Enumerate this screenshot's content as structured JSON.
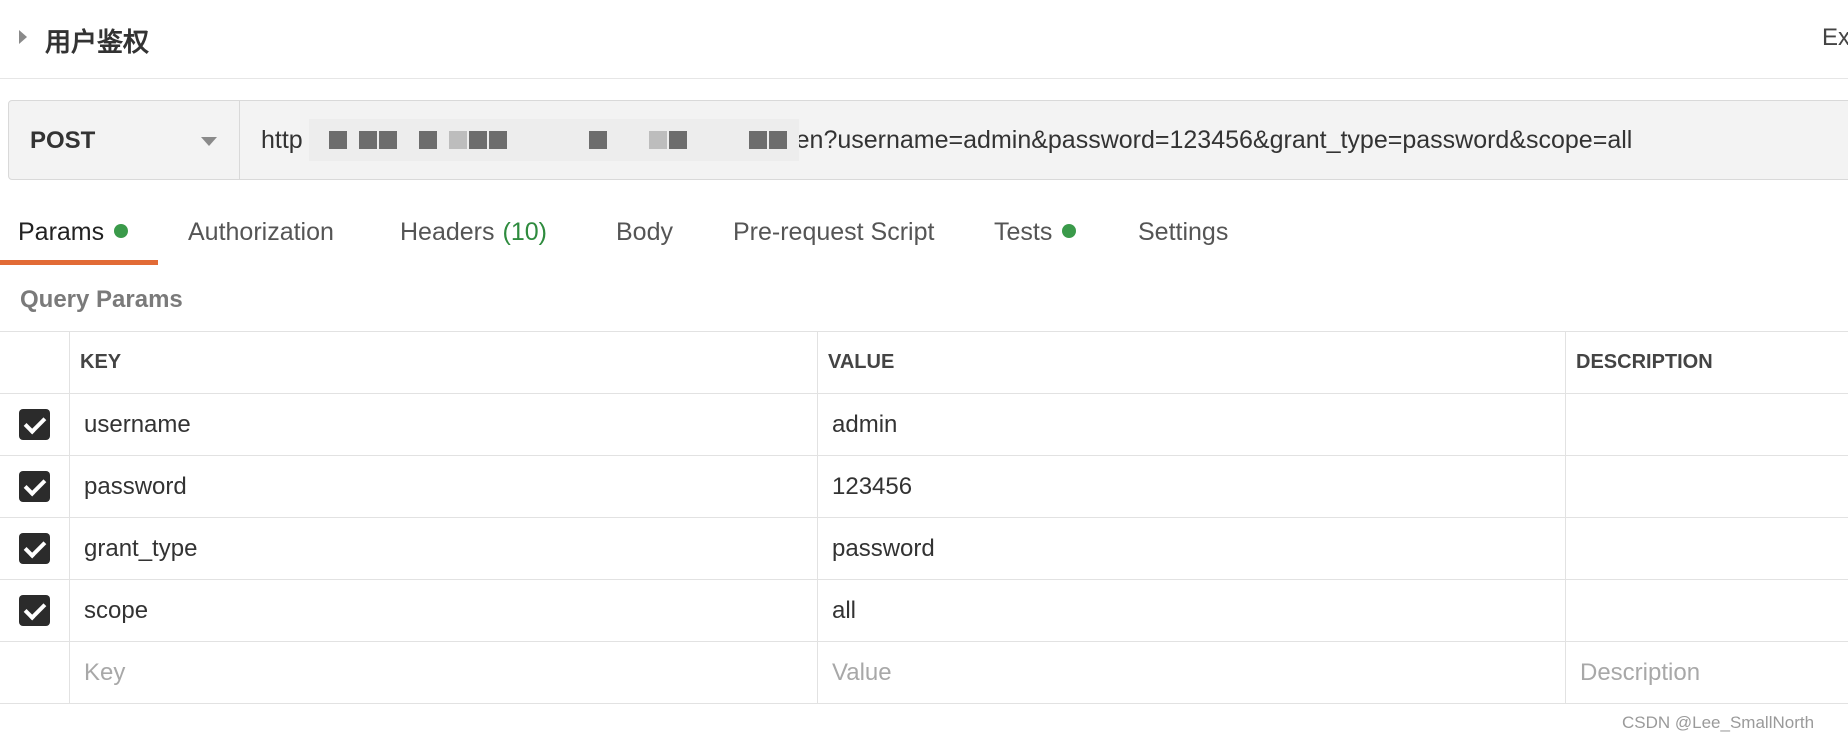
{
  "header": {
    "collection_title": "用户鉴权",
    "right_text": "Ex"
  },
  "request": {
    "method": "POST",
    "url_prefix": "http",
    "url_suffix": "auth/token?username=admin&password=123456&grant_type=password&scope=all"
  },
  "tabs": [
    {
      "label": "Params",
      "dot": true,
      "active": true
    },
    {
      "label": "Authorization"
    },
    {
      "label": "Headers",
      "count": "(10)"
    },
    {
      "label": "Body"
    },
    {
      "label": "Pre-request Script"
    },
    {
      "label": "Tests",
      "dot": true
    },
    {
      "label": "Settings"
    }
  ],
  "query_params": {
    "title": "Query Params",
    "columns": {
      "key": "KEY",
      "value": "VALUE",
      "description": "DESCRIPTION"
    },
    "rows": [
      {
        "key": "username",
        "value": "admin",
        "description": "",
        "checked": true
      },
      {
        "key": "password",
        "value": "123456",
        "description": "",
        "checked": true
      },
      {
        "key": "grant_type",
        "value": "password",
        "description": "",
        "checked": true
      },
      {
        "key": "scope",
        "value": "all",
        "description": "",
        "checked": true
      }
    ],
    "placeholders": {
      "key": "Key",
      "value": "Value",
      "description": "Description"
    }
  },
  "watermark": "CSDN @Lee_SmallNorth",
  "colors": {
    "accent_underline": "#e26b36",
    "status_dot": "#3a9a4a",
    "header_count": "#2e8b3e"
  }
}
